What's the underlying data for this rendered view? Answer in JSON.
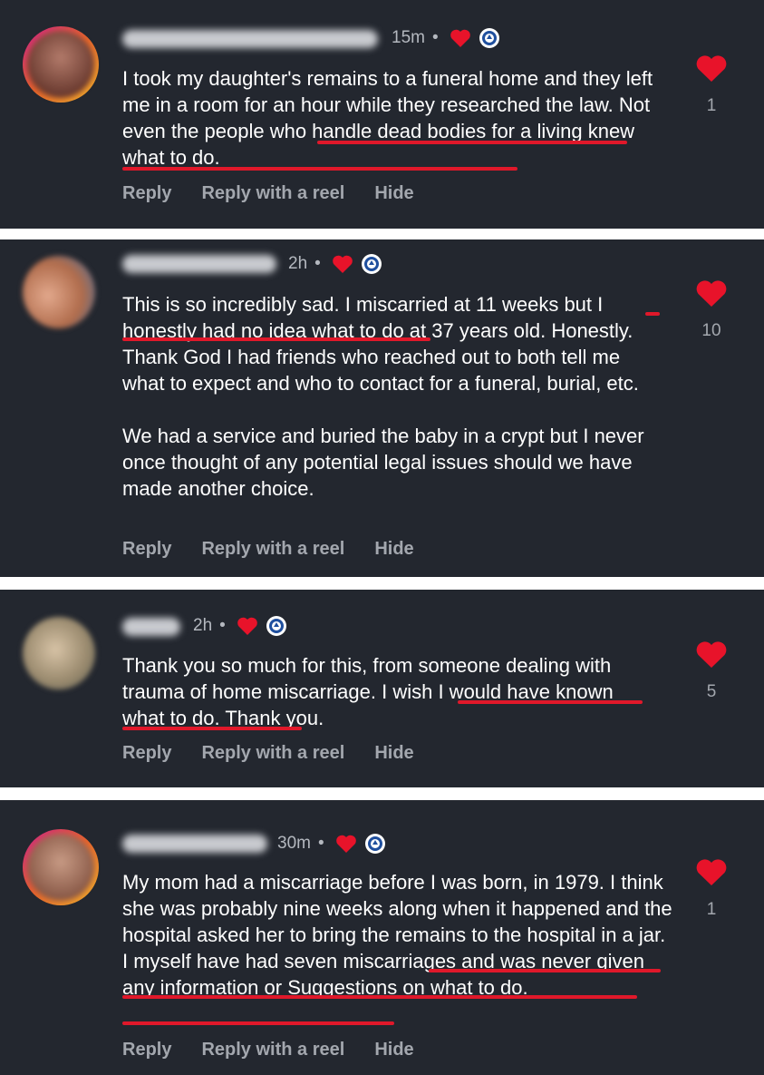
{
  "comments": [
    {
      "time": "15m",
      "paragraphs": [
        "I took my daughter's remains to a funeral home and they left me in a room for an hour while they researched the law. Not even the people who handle dead bodies for a living knew what to do."
      ],
      "likes": "1",
      "actions": [
        "Reply",
        "Reply with a reel",
        "Hide"
      ]
    },
    {
      "time": "2h",
      "paragraphs": [
        "This is so incredibly sad. I miscarried at 11 weeks but I honestly had no idea what to do at 37 years old. Honestly. Thank God I had friends who reached out to both tell me what to expect and who to contact for a funeral, burial, etc.",
        "We had a service and buried the baby in a crypt but I never once thought of any potential legal issues should we have made another choice."
      ],
      "likes": "10",
      "actions": [
        "Reply",
        "Reply with a reel",
        "Hide"
      ]
    },
    {
      "time": "2h",
      "paragraphs": [
        "Thank you so much for this, from someone dealing with trauma of home miscarriage. I wish I would have known what to do. Thank you."
      ],
      "likes": "5",
      "actions": [
        "Reply",
        "Reply with a reel",
        "Hide"
      ]
    },
    {
      "time": "30m",
      "paragraphs": [
        "My mom had a miscarriage before I was born, in 1979. I think she was probably nine weeks along when it happened and the hospital asked her to bring the remains to the hospital in a jar. I myself have had seven miscarriages and was never given any information or Suggestions on what to do."
      ],
      "likes": "1",
      "actions": [
        "Reply",
        "Reply with a reel",
        "Hide"
      ]
    }
  ],
  "icons": {
    "reaction": "heart-icon",
    "badge": "top-fan-badge-icon",
    "like": "heart-icon"
  },
  "colors": {
    "panel_bg": "#23272f",
    "page_bg": "#ffffff",
    "heart": "#e8132a",
    "underline": "#e0182a",
    "text": "#ffffff",
    "muted": "#a3a7ae"
  }
}
